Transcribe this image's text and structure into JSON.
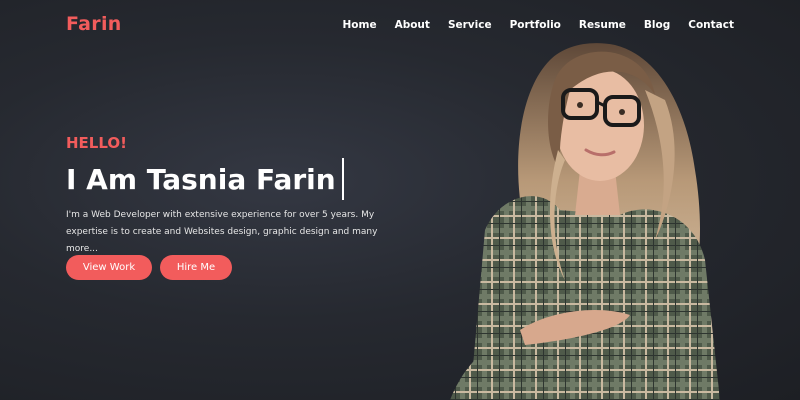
{
  "brand": {
    "logo": "Farin",
    "accent": "#f25c5c"
  },
  "nav": [
    "Home",
    "About",
    "Service",
    "Portfolio",
    "Resume",
    "Blog",
    "Contact"
  ],
  "hero": {
    "greeting": "HELLO!",
    "headline": "I Am Tasnia Farin",
    "description": "I'm a Web Developer with extensive experience for over 5 years. My expertise is to create and Websites design, graphic design and many more...",
    "buttons": {
      "view_work": "View Work",
      "hire_me": "Hire Me"
    },
    "portrait_icon": "woman-portrait-image"
  }
}
